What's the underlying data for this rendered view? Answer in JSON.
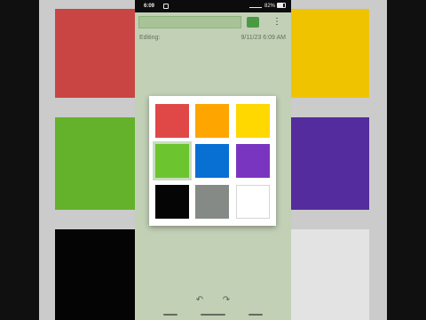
{
  "status_bar": {
    "time": "6:09",
    "battery": "82%"
  },
  "app_bar": {
    "title_value": "",
    "current_color": "#51a84a",
    "more_icon": "more-vert-icon"
  },
  "note": {
    "editing_label": "Editing:",
    "edited_date": "9/11/23 6:09 AM"
  },
  "color_picker": {
    "colors": [
      {
        "name": "red",
        "hex": "#e04848"
      },
      {
        "name": "orange",
        "hex": "#ffa500"
      },
      {
        "name": "yellow",
        "hex": "#ffd800"
      },
      {
        "name": "green",
        "hex": "#6cc52e",
        "selected": true
      },
      {
        "name": "blue",
        "hex": "#0970d3"
      },
      {
        "name": "purple",
        "hex": "#7a35c0"
      },
      {
        "name": "black",
        "hex": "#050505"
      },
      {
        "name": "gray",
        "hex": "#858a86"
      },
      {
        "name": "white",
        "hex": "#ffffff"
      }
    ]
  },
  "bottom_bar": {
    "undo_icon": "undo-icon",
    "redo_icon": "redo-icon"
  }
}
